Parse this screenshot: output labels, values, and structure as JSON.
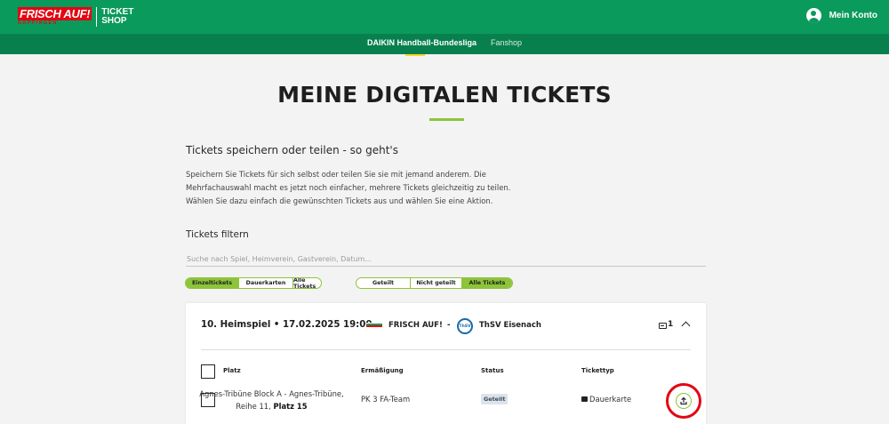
{
  "header": {
    "logo_main": "FRISCH AUF!",
    "logo_sub": "GÖPPINGEN",
    "logo_shop_1": "TICKET",
    "logo_shop_2": "SHOP",
    "account_label": "Mein Konto"
  },
  "nav": {
    "items": [
      {
        "label": "DAIKIN Handball-Bundesliga",
        "active": true
      },
      {
        "label": "Fanshop",
        "active": false
      }
    ]
  },
  "page": {
    "title": "MEINE DIGITALEN TICKETS",
    "howto_title": "Tickets speichern oder teilen - so geht's",
    "howto_text": "Speichern Sie Tickets für sich selbst oder teilen Sie sie mit jemand anderem. Die Mehrfachauswahl macht es jetzt noch einfacher, mehrere Tickets gleichzeitig zu teilen. Wählen Sie dazu einfach die gewünschten Tickets aus und wählen Sie eine Aktion.",
    "filter_title": "Tickets filtern",
    "search_placeholder": "Suche nach Spiel, Heimverein, Gastverein, Datum..."
  },
  "filters": {
    "type": [
      "Einzeltickets",
      "Dauerkarten",
      "Alle Tickets"
    ],
    "type_active": "Einzeltickets",
    "share": [
      "Geteilt",
      "Nicht geteilt",
      "Alle Tickets"
    ],
    "share_active": "Alle Tickets"
  },
  "event": {
    "title": "10. Heimspiel • 17.02.2025 19:00",
    "home_team": "FRISCH AUF!",
    "separator": "-",
    "away_team": "ThSV Eisenach",
    "away_logo_text": "ThSV",
    "ticket_count": "1",
    "columns": {
      "platz": "Platz",
      "ermaessigung": "Ermäßigung",
      "status": "Status",
      "tickettyp": "Tickettyp"
    },
    "ticket": {
      "platz_line": "Agnes-Tribüne Block A - Agnes-Tribüne, Reihe 11,",
      "platz_seat": "Platz 15",
      "ermaessigung": "PK 3 FA-Team",
      "status": "Geteilt",
      "tickettyp": "Dauerkarte"
    }
  },
  "colors": {
    "brand_green": "#0a9a5c",
    "accent_green": "#8dc43a",
    "highlight_red": "#e30613"
  }
}
